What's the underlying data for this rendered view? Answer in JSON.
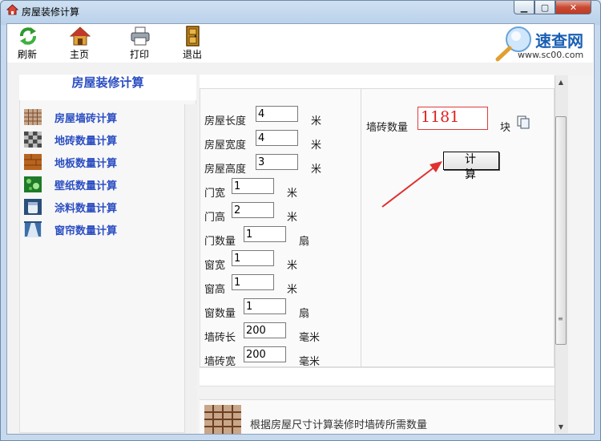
{
  "window": {
    "title": "房屋装修计算"
  },
  "toolbar": {
    "items": [
      {
        "label": "刷新",
        "icon": "refresh-icon"
      },
      {
        "label": "主页",
        "icon": "home-icon"
      },
      {
        "label": "打印",
        "icon": "printer-icon"
      },
      {
        "label": "退出",
        "icon": "exit-door-icon"
      }
    ]
  },
  "brand": {
    "name": "速查网",
    "url": "www.sc00.com"
  },
  "sidebar": {
    "title": "房屋装修计算",
    "items": [
      {
        "label": "房屋墙砖计算",
        "icon": "wall-tile-icon"
      },
      {
        "label": "地砖数量计算",
        "icon": "floor-tile-icon"
      },
      {
        "label": "地板数量计算",
        "icon": "wood-floor-icon"
      },
      {
        "label": "壁纸数量计算",
        "icon": "wallpaper-icon"
      },
      {
        "label": "涂料数量计算",
        "icon": "paint-icon"
      },
      {
        "label": "窗帘数量计算",
        "icon": "curtain-icon"
      }
    ]
  },
  "form": {
    "fields": [
      {
        "label": "房屋长度",
        "value": "4",
        "unit": "米"
      },
      {
        "label": "房屋宽度",
        "value": "4",
        "unit": "米"
      },
      {
        "label": "房屋高度",
        "value": "3",
        "unit": "米"
      },
      {
        "label": "门宽",
        "value": "1",
        "unit": "米"
      },
      {
        "label": "门高",
        "value": "2",
        "unit": "米"
      },
      {
        "label": "门数量",
        "value": "1",
        "unit": "扇"
      },
      {
        "label": "窗宽",
        "value": "1",
        "unit": "米"
      },
      {
        "label": "窗高",
        "value": "1",
        "unit": "米"
      },
      {
        "label": "窗数量",
        "value": "1",
        "unit": "扇"
      },
      {
        "label": "墙砖长",
        "value": "200",
        "unit": "毫米"
      },
      {
        "label": "墙砖宽",
        "value": "200",
        "unit": "毫米"
      }
    ],
    "result": {
      "label": "墙砖数量",
      "value": "1181",
      "unit": "块"
    },
    "calc_button": "计 算"
  },
  "footer": {
    "description": "根据房屋尺寸计算装修时墙砖所需数量"
  },
  "colors": {
    "accent": "#2b4ec2",
    "result_red": "#e02020",
    "arrow_red": "#e03030"
  }
}
